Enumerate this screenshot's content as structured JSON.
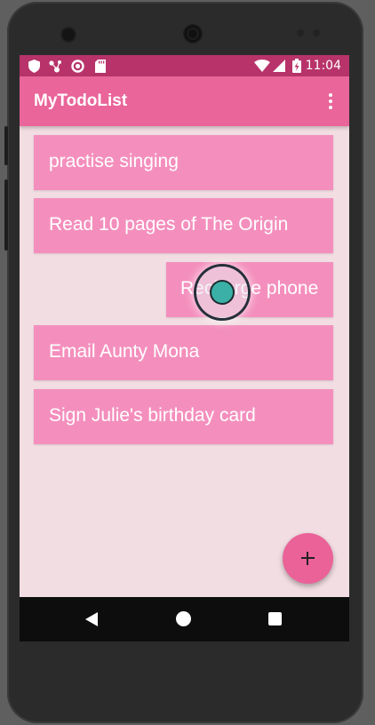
{
  "status_bar": {
    "time": "11:04",
    "icons": [
      "shield-icon",
      "network-icon",
      "sync-icon",
      "sd-card-icon",
      "wifi-icon",
      "signal-icon",
      "battery-charging-icon"
    ]
  },
  "app_bar": {
    "title": "MyTodoList",
    "overflow_icon": "more-vert-icon"
  },
  "todo_items": [
    {
      "label": "practise singing"
    },
    {
      "label": "Read 10 pages of The Origin"
    },
    {
      "label": "Recharge phone",
      "state": "swiping"
    },
    {
      "label": "Email Aunty Mona"
    },
    {
      "label": "Sign Julie's birthday card"
    }
  ],
  "fab": {
    "icon": "add-icon",
    "symbol": "+"
  },
  "navigation_bar": {
    "icons": [
      "back-icon",
      "home-icon",
      "recents-icon"
    ]
  },
  "colors": {
    "status_bar": "#b7336a",
    "app_bar": "#e9659a",
    "item_background": "#f48fbd",
    "screen_background": "#f1dde2",
    "fab": "#ea6298"
  }
}
